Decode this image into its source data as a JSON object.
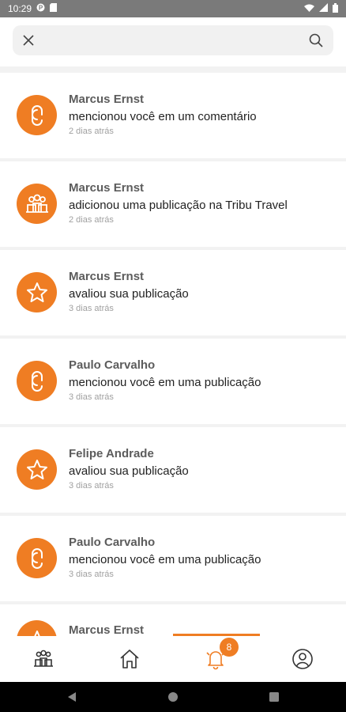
{
  "status_bar": {
    "time": "10:29",
    "icons": [
      "notification-dot-icon",
      "sim-card-icon",
      "wifi-icon",
      "signal-icon",
      "battery-icon"
    ]
  },
  "search": {
    "value": "",
    "placeholder": "",
    "close_icon": "close-icon",
    "search_icon": "search-icon"
  },
  "notifications": [
    {
      "name": "Marcus Ernst",
      "action": "mencionou você em um comentário",
      "time": "2 dias atrás",
      "icon": "mention-icon"
    },
    {
      "name": "Marcus Ernst",
      "action": "adicionou uma publicação na Tribu Travel",
      "time": "2 dias atrás",
      "icon": "group-icon"
    },
    {
      "name": "Marcus Ernst",
      "action": "avaliou sua publicação",
      "time": "3 dias atrás",
      "icon": "star-icon"
    },
    {
      "name": "Paulo Carvalho",
      "action": "mencionou você em uma publicação",
      "time": "3 dias atrás",
      "icon": "mention-icon"
    },
    {
      "name": "Felipe Andrade",
      "action": "avaliou sua publicação",
      "time": "3 dias atrás",
      "icon": "star-icon"
    },
    {
      "name": "Paulo Carvalho",
      "action": "mencionou você em uma publicação",
      "time": "3 dias atrás",
      "icon": "mention-icon"
    },
    {
      "name": "Marcus Ernst",
      "action": "",
      "time": "",
      "icon": "star-icon"
    }
  ],
  "bottom_nav": {
    "items": [
      {
        "icon": "tribes-icon",
        "active": false
      },
      {
        "icon": "home-icon",
        "active": false
      },
      {
        "icon": "bell-icon",
        "active": true,
        "badge": "8"
      },
      {
        "icon": "profile-icon",
        "active": false
      }
    ]
  },
  "system_nav": [
    "back-icon",
    "home-circle-icon",
    "recents-icon"
  ],
  "colors": {
    "accent": "#ef7d23",
    "status_bar": "#7a7a7a",
    "list_background": "#f2f2f2",
    "name_text": "#5c5c5c",
    "time_text": "#a0a0a0"
  }
}
